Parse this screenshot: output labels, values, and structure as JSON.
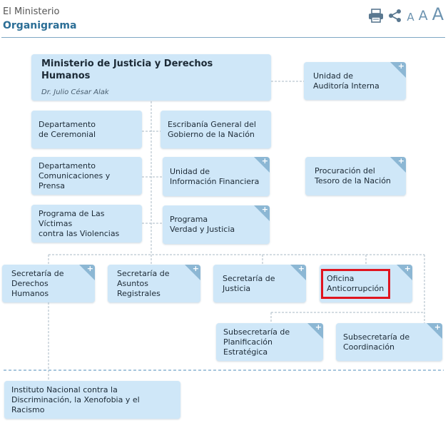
{
  "header": {
    "breadcrumb": "El Ministerio",
    "title": "Organigrama",
    "icons": [
      "print-icon",
      "share-icon"
    ],
    "font_size_labels": [
      "A",
      "A",
      "A"
    ]
  },
  "org": {
    "main": {
      "name": "Ministerio de Justicia y Derechos Humanos",
      "head": "Dr. Julio César Alak"
    },
    "auditoria": {
      "name": "Unidad de\nAuditoría Interna"
    },
    "ceremonial": {
      "name": "Departamento\nde Ceremonial"
    },
    "escribania": {
      "name": "Escribanía General del\nGobierno de la Nación"
    },
    "comunicaciones": {
      "name": "Departamento\nComunicaciones y Prensa"
    },
    "uif": {
      "name": "Unidad de\nInformación Financiera"
    },
    "procuracion": {
      "name": "Procuración del\nTesoro de la Nación"
    },
    "victimas": {
      "name": "Programa de Las Víctimas\ncontra las Violencias"
    },
    "verdad": {
      "name": "Programa\nVerdad y Justicia"
    },
    "ddhh": {
      "name": "Secretaría de\nDerechos Humanos"
    },
    "registrales": {
      "name": "Secretaría de\nAsuntos Registrales"
    },
    "justicia": {
      "name": "Secretaría de\nJusticia"
    },
    "anticorrupcion": {
      "name": "Oficina\nAnticorrupción"
    },
    "planificacion": {
      "name": "Subsecretaría de\nPlanificación Estratégica"
    },
    "coordinacion": {
      "name": "Subsecretaría de\nCoordinación"
    },
    "inadi": {
      "name": "Instituto Nacional contra la\nDiscriminación, la Xenofobia y el Racismo"
    }
  },
  "colors": {
    "node_fill": "#cfe7f8",
    "plus_corner": "#8cb7d4",
    "connector": "#a9b8c4",
    "highlight": "#e0141f",
    "title": "#2b6e96"
  }
}
